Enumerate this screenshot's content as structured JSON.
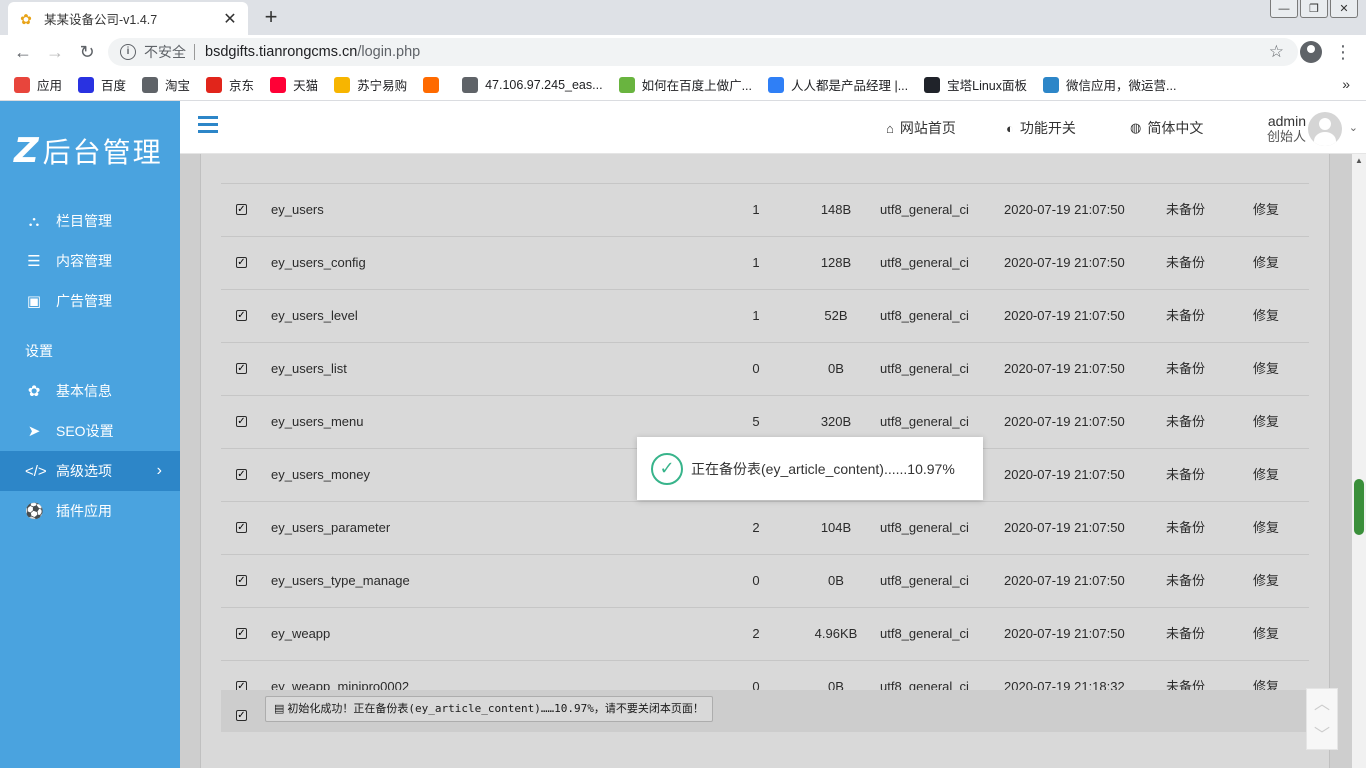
{
  "browser": {
    "tab_title": "某某设备公司-v1.4.7",
    "insecure_label": "不安全",
    "url_host": "bsdgifts.tianrongcms.cn",
    "url_path": "/login.php",
    "bookmarks": [
      {
        "label": "应用",
        "icon": "apps-icon",
        "color": "#e8453c"
      },
      {
        "label": "百度",
        "icon": "baidu-icon",
        "color": "#2932e1"
      },
      {
        "label": "淘宝",
        "icon": "globe-icon",
        "color": "#5f6368"
      },
      {
        "label": "京东",
        "icon": "jd-icon",
        "color": "#e1251b"
      },
      {
        "label": "天猫",
        "icon": "tmall-icon",
        "color": "#ff0036"
      },
      {
        "label": "苏宁易购",
        "icon": "suning-icon",
        "color": "#f7b500"
      },
      {
        "label": "",
        "icon": "bracket-icon",
        "color": "#ff6a00"
      },
      {
        "label": "47.106.97.245_eas...",
        "icon": "globe-icon",
        "color": "#5f6368"
      },
      {
        "label": "如何在百度上做广...",
        "icon": "baidu-green-icon",
        "color": "#69b43f"
      },
      {
        "label": "人人都是产品经理 |...",
        "icon": "rr-icon",
        "color": "#2f7ff6"
      },
      {
        "label": "宝塔Linux面板",
        "icon": "bt-icon",
        "color": "#20232a"
      },
      {
        "label": "微信应用，微运营...",
        "icon": "m-icon",
        "color": "#2d86c8"
      }
    ],
    "more": "»"
  },
  "sidebar": {
    "logo_mark": "Z",
    "logo_text": "后台管理",
    "items": [
      {
        "label": "栏目管理",
        "icon": "sitemap-icon",
        "glyph": "⛬"
      },
      {
        "label": "内容管理",
        "icon": "list-icon",
        "glyph": "☰"
      },
      {
        "label": "广告管理",
        "icon": "image-icon",
        "glyph": "▣"
      }
    ],
    "section": "设置",
    "settings_items": [
      {
        "label": "基本信息",
        "icon": "gear-icon",
        "glyph": "✿"
      },
      {
        "label": "SEO设置",
        "icon": "paper-plane-icon",
        "glyph": "➤"
      },
      {
        "label": "高级选项",
        "icon": "code-icon",
        "glyph": "</>",
        "active": true
      },
      {
        "label": "插件应用",
        "icon": "soccer-ball-icon",
        "glyph": "⚽"
      }
    ]
  },
  "header": {
    "home": "网站首页",
    "features": "功能开关",
    "language": "简体中文",
    "user_name": "admin",
    "user_role": "创始人"
  },
  "table": {
    "rows": [
      {
        "name": "ey_users",
        "records": "1",
        "size": "148B",
        "collation": "utf8_general_ci",
        "time": "2020-07-19 21:07:50",
        "status": "未备份",
        "action": "修复"
      },
      {
        "name": "ey_users_config",
        "records": "1",
        "size": "128B",
        "collation": "utf8_general_ci",
        "time": "2020-07-19 21:07:50",
        "status": "未备份",
        "action": "修复"
      },
      {
        "name": "ey_users_level",
        "records": "1",
        "size": "52B",
        "collation": "utf8_general_ci",
        "time": "2020-07-19 21:07:50",
        "status": "未备份",
        "action": "修复"
      },
      {
        "name": "ey_users_list",
        "records": "0",
        "size": "0B",
        "collation": "utf8_general_ci",
        "time": "2020-07-19 21:07:50",
        "status": "未备份",
        "action": "修复"
      },
      {
        "name": "ey_users_menu",
        "records": "5",
        "size": "320B",
        "collation": "utf8_general_ci",
        "time": "2020-07-19 21:07:50",
        "status": "未备份",
        "action": "修复"
      },
      {
        "name": "ey_users_money",
        "records": "",
        "size": "",
        "collation": "",
        "time": "2020-07-19 21:07:50",
        "status": "未备份",
        "action": "修复"
      },
      {
        "name": "ey_users_parameter",
        "records": "2",
        "size": "104B",
        "collation": "utf8_general_ci",
        "time": "2020-07-19 21:07:50",
        "status": "未备份",
        "action": "修复"
      },
      {
        "name": "ey_users_type_manage",
        "records": "0",
        "size": "0B",
        "collation": "utf8_general_ci",
        "time": "2020-07-19 21:07:50",
        "status": "未备份",
        "action": "修复"
      },
      {
        "name": "ey_weapp",
        "records": "2",
        "size": "4.96KB",
        "collation": "utf8_general_ci",
        "time": "2020-07-19 21:07:50",
        "status": "未备份",
        "action": "修复"
      },
      {
        "name": "ey_weapp_minipro0002",
        "records": "0",
        "size": "0B",
        "collation": "utf8_general_ci",
        "time": "2020-07-19 21:18:32",
        "status": "未备份",
        "action": "修复"
      }
    ],
    "footer_message": "初始化成功！正在备份表(ey_article_content)……10.97%，请不要关闭本页面！"
  },
  "toast": {
    "message": "正在备份表(ey_article_content)......10.97%"
  }
}
